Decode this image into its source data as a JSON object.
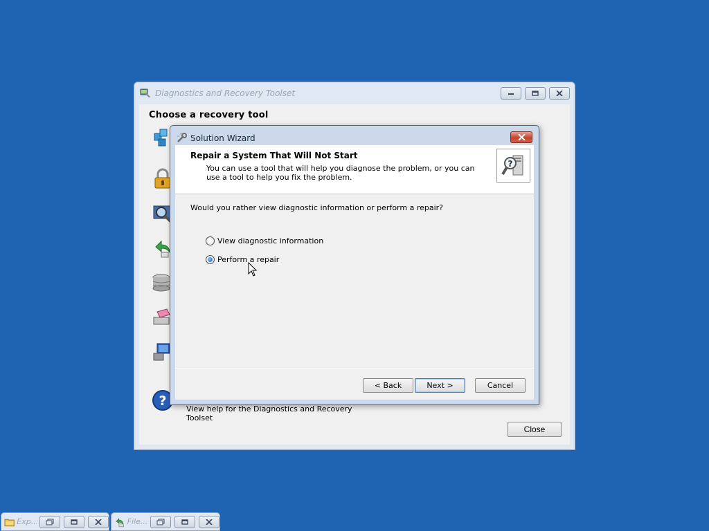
{
  "desktop": {
    "background": "#1f63b3"
  },
  "dart_window": {
    "title": "Diagnostics and Recovery Toolset",
    "heading": "Choose a recovery tool",
    "help_text": "View help for the Diagnostics and Recovery Toolset",
    "close_label": "Close",
    "tool_icons": [
      "registry-editor-icon",
      "locksmith-icon",
      "crash-analyzer-icon",
      "file-restore-icon",
      "disk-commander-icon",
      "disk-wipe-icon",
      "computer-management-icon",
      "help-icon"
    ]
  },
  "wizard": {
    "title": "Solution Wizard",
    "header_title": "Repair a System That Will Not Start",
    "header_desc": "You can use a tool that will help you diagnose the problem, or you can use a tool to help you fix the problem.",
    "question": "Would you rather view diagnostic information or perform a repair?",
    "options": [
      {
        "label": "View diagnostic information",
        "selected": false
      },
      {
        "label": "Perform a repair",
        "selected": true
      }
    ],
    "buttons": {
      "back": "< Back",
      "next": "Next >",
      "cancel": "Cancel"
    }
  },
  "taskbar": {
    "items": [
      {
        "title": "Exp..."
      },
      {
        "title": "File..."
      }
    ]
  }
}
